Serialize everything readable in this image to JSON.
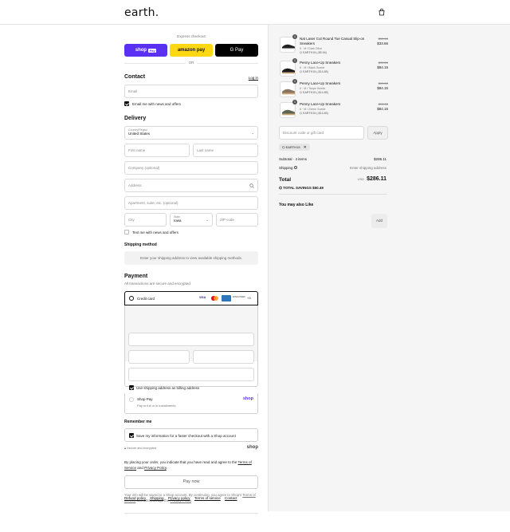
{
  "header": {
    "logo": "earth.",
    "cart_icon": "shopping-bag-icon"
  },
  "express": {
    "title": "Express checkout",
    "shop_pay": "shop",
    "shop_pay_suffix": "Pay",
    "amazon_pay": "amazon pay",
    "google_pay": "G Pay",
    "or": "OR"
  },
  "contact": {
    "heading": "Contact",
    "login": "Log in",
    "email_placeholder": "Email",
    "news_label": "Email me with news and offers"
  },
  "delivery": {
    "heading": "Delivery",
    "country_label": "Country/Region",
    "country_value": "United States",
    "first_name": "First name",
    "last_name": "Last name",
    "company": "Company (optional)",
    "address": "Address",
    "apartment": "Apartment, suite, etc. (optional)",
    "city": "City",
    "state_label": "State",
    "state_value": "Iowa",
    "zip": "ZIP code",
    "text_label": "Text me with news and offers"
  },
  "shipping": {
    "heading": "Shipping method",
    "message": "Enter your shipping address to view available shipping methods."
  },
  "payment": {
    "heading": "Payment",
    "subtitle": "All transactions are secure and encrypted.",
    "credit_card": "Credit card",
    "card_brands": [
      "Visa",
      "MC",
      "AMEX",
      "DISCOVER"
    ],
    "more_brands": "+3",
    "billing_label": "Use shipping address as billing address",
    "shop_pay_label": "Shop Pay",
    "shop_pay_sub": "Pay in full or in installments",
    "shop_pay_logo": "shop"
  },
  "remember": {
    "heading": "Remember me",
    "save_label": "Save my information for a faster checkout with a Shop account",
    "secure": "Secure and encrypted",
    "shop_logo": "shop"
  },
  "legal": {
    "agree_prefix": "By placing your order, you indicate that you have read and agree to the",
    "terms": "Terms of Service",
    "and": "and",
    "privacy": "Privacy Policy",
    "pay_now": "Pay now",
    "info_prefix": "Your info will be saved to a Shop account. By continuing, you agree to Shop's",
    "info_terms": "Terms of Service",
    "info_mid": "and acknowledge the",
    "info_privacy": "Privacy Policy"
  },
  "footer": {
    "links": [
      "Refund policy",
      "Shipping",
      "Privacy policy",
      "Terms of service",
      "Contact"
    ]
  },
  "cart": {
    "items": [
      {
        "qty": "1",
        "name": "Nat Laser Cut Round Toe Casual Slip-on Sneakers",
        "variant": "5 · M / Dark Olive",
        "discount": "EARTH15 (-$5.94)",
        "original": "$39.60",
        "price": "$33.66"
      },
      {
        "qty": "1",
        "name": "Penny Lace-Up Sneakers",
        "variant": "6 · M / Black Suede",
        "discount": "EARTH15 (-$14.85)",
        "original": "$99.00",
        "price": "$84.15"
      },
      {
        "qty": "1",
        "name": "Penny Lace-Up Sneakers",
        "variant": "6 · M / Taupe Suede",
        "discount": "EARTH15 (-$14.85)",
        "original": "$99.00",
        "price": "$84.15"
      },
      {
        "qty": "1",
        "name": "Penny Lace-Up Sneakers",
        "variant": "6 · M / Green Suede",
        "discount": "EARTH15 (-$14.85)",
        "original": "$99.00",
        "price": "$84.15"
      }
    ],
    "discount_placeholder": "Discount code or gift card",
    "apply": "Apply",
    "code_tag": "EARTH15",
    "subtotal_label": "Subtotal · 4 items",
    "subtotal_value": "$286.11",
    "shipping_label": "Shipping",
    "shipping_value": "Enter shipping address",
    "total_label": "Total",
    "total_currency": "USD",
    "total_value": "$286.11",
    "savings_label": "TOTAL SAVINGS",
    "savings_value": "$50.49",
    "like_heading": "You may also Like",
    "add": "Add"
  },
  "colors": {
    "shop_pay": "#5a31f4",
    "amazon_pay": "#ffd814",
    "google_pay": "#000000",
    "accent": "#111111"
  }
}
